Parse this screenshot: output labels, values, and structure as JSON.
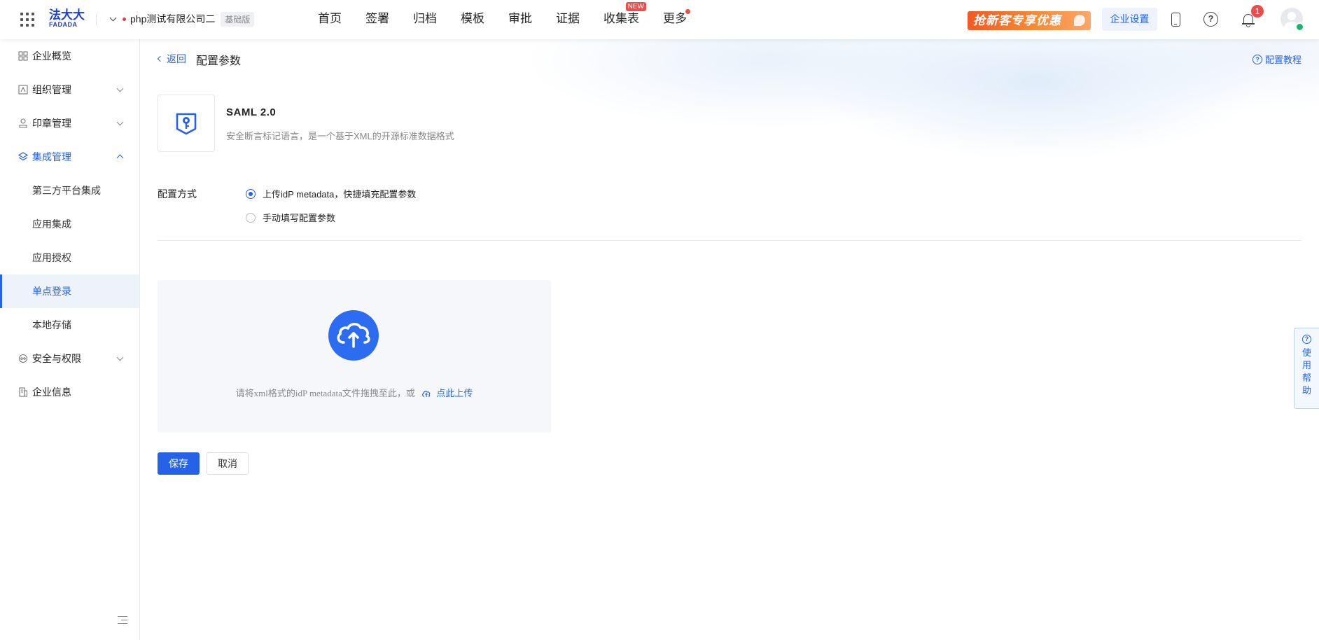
{
  "header": {
    "logo_cn": "法大大",
    "logo_en": "FADADA",
    "company_name": "php测试有限公司二",
    "plan_badge": "基础版",
    "nav": [
      {
        "label": "首页"
      },
      {
        "label": "签署"
      },
      {
        "label": "归档"
      },
      {
        "label": "模板"
      },
      {
        "label": "审批"
      },
      {
        "label": "证据"
      },
      {
        "label": "收集表",
        "badge": "NEW"
      },
      {
        "label": "更多"
      }
    ],
    "promo_text": "抢新客专享优惠",
    "enterprise_settings": "企业设置",
    "notification_count": "1",
    "colors": {
      "brand_blue": "#2662e8",
      "promo_orange": "#f15a24",
      "alert_red": "#ef4b4b",
      "verified_green": "#1bb46b"
    }
  },
  "sidebar": {
    "items": [
      {
        "label": "企业概览",
        "icon": "dashboard-icon"
      },
      {
        "label": "组织管理",
        "icon": "org-icon",
        "expandable": true
      },
      {
        "label": "印章管理",
        "icon": "seal-icon",
        "expandable": true
      },
      {
        "label": "集成管理",
        "icon": "layers-icon",
        "expandable": true,
        "expanded": true
      },
      {
        "label": "安全与权限",
        "icon": "security-icon",
        "expandable": true
      },
      {
        "label": "企业信息",
        "icon": "building-icon"
      }
    ],
    "sub_items": [
      {
        "label": "第三方平台集成"
      },
      {
        "label": "应用集成"
      },
      {
        "label": "应用授权"
      },
      {
        "label": "单点登录",
        "active": true
      },
      {
        "label": "本地存储"
      }
    ]
  },
  "main": {
    "back_label": "返回",
    "page_title": "配置参数",
    "tutorial_label": "配置教程",
    "saml": {
      "title": "SAML 2.0",
      "description": "安全断言标记语言，是一个基于XML的开源标准数据格式"
    },
    "config": {
      "label": "配置方式",
      "options": [
        {
          "label": "上传idP metadata，快捷填充配置参数",
          "checked": true
        },
        {
          "label": "手动填写配置参数",
          "checked": false
        }
      ]
    },
    "upload": {
      "hint": "请将xml格式的idP metadata文件拖拽至此，或",
      "link": "点此上传"
    },
    "save_label": "保存",
    "cancel_label": "取消"
  },
  "help_float": {
    "label": "使用帮助"
  }
}
